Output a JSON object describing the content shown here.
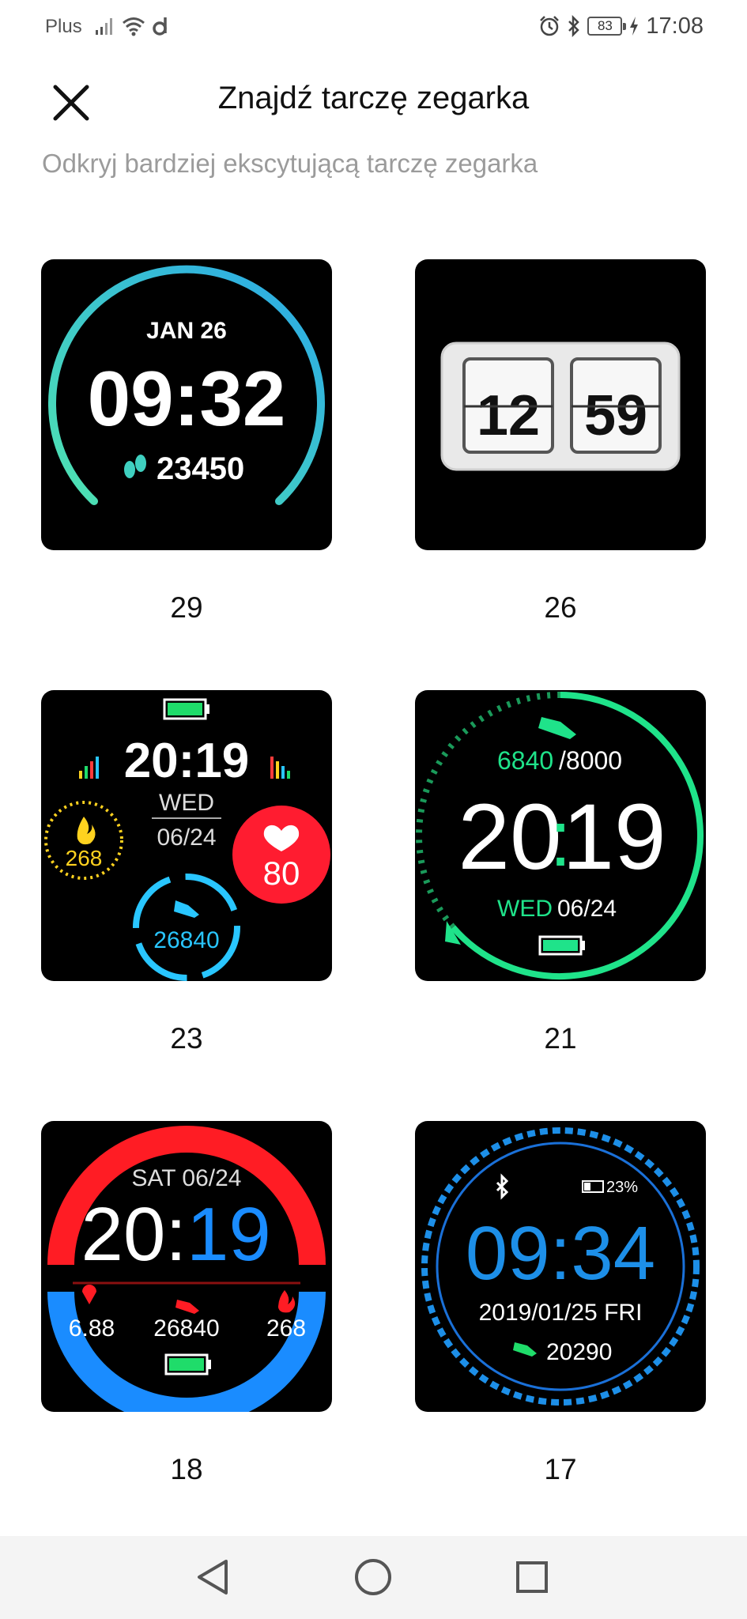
{
  "status_bar": {
    "carrier": "Plus",
    "battery": "83",
    "time": "17:08",
    "icons": [
      "signal-icon",
      "wifi-icon",
      "data-icon",
      "alarm-icon",
      "bluetooth-icon",
      "battery-icon",
      "charging-icon"
    ]
  },
  "header": {
    "title": "Znajdź tarczę zegarka",
    "subtitle": "Odkryj bardziej ekscytującą tarczę zegarka",
    "close_icon": "close-icon"
  },
  "faces": [
    {
      "id": "29",
      "date": "JAN  26",
      "time": "09:32",
      "steps": "23450"
    },
    {
      "id": "26",
      "hour": "12",
      "minute": "59"
    },
    {
      "id": "23",
      "time": "20:19",
      "day": "WED",
      "date": "06/24",
      "calories": "268",
      "heart": "80",
      "steps": "26840"
    },
    {
      "id": "21",
      "steps": "6840",
      "goal": "/8000",
      "hour": "20",
      "colon": ":",
      "minute": "19",
      "day": "WED",
      "date": "06/24"
    },
    {
      "id": "18",
      "daydate": "SAT  06/24",
      "hour": "20:",
      "minute": "19",
      "distance": "6.88",
      "steps": "26840",
      "calories": "268"
    },
    {
      "id": "17",
      "battery": "23%",
      "time": "09:34",
      "date": "2019/01/25  FRI",
      "steps": "20290"
    }
  ],
  "colors": {
    "face29_arc": "#3fd0c0",
    "face21_green": "#1fe38a",
    "face18_red": "#ff1c24",
    "face18_blue": "#1a8cff",
    "face17_blue": "#1d8fe8"
  },
  "nav": {
    "back_icon": "back-triangle-icon",
    "home_icon": "home-circle-icon",
    "recents_icon": "recents-square-icon"
  }
}
